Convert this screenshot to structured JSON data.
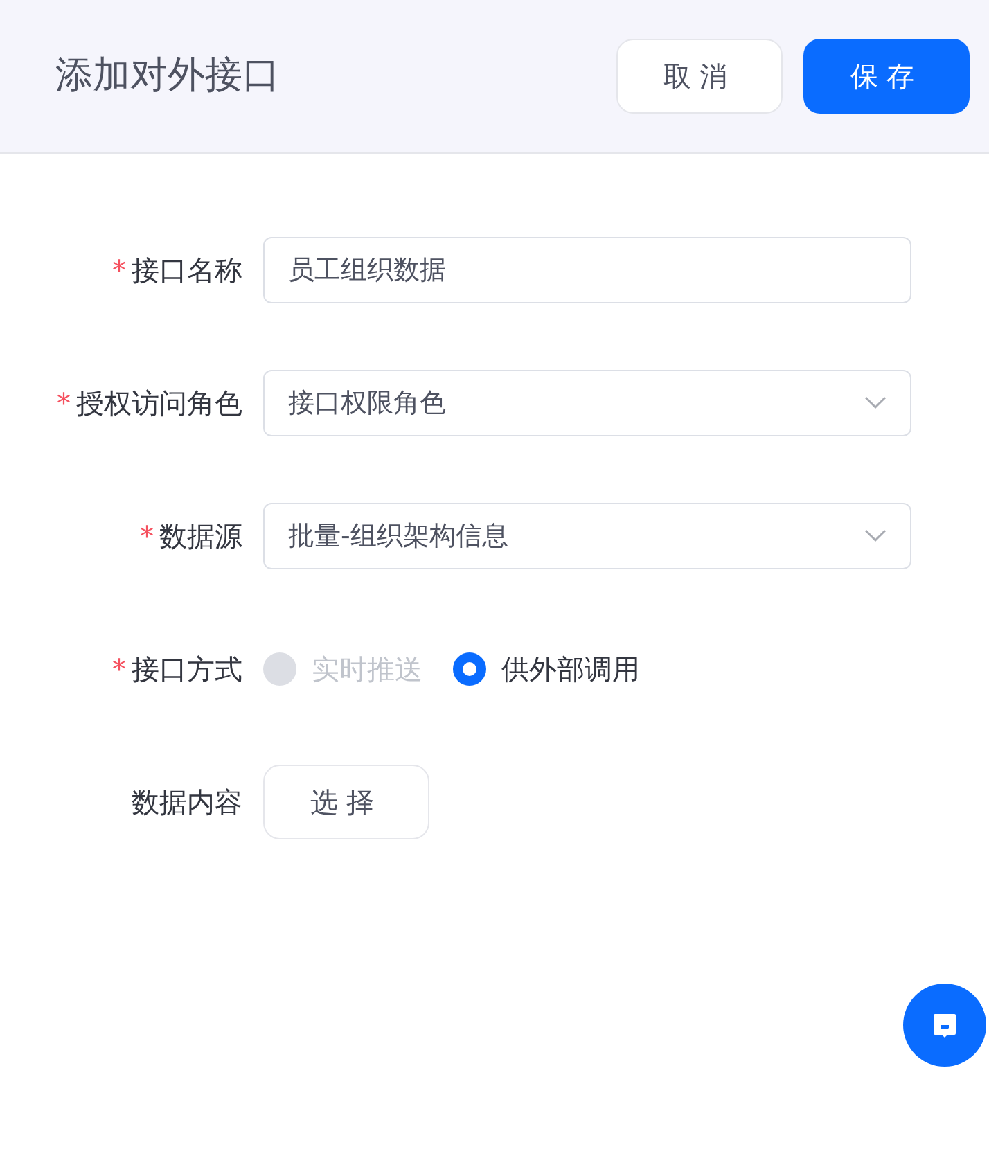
{
  "header": {
    "title": "添加对外接口",
    "buttons": [
      {
        "label": "取消",
        "kind": "secondary"
      },
      {
        "label": "保存",
        "kind": "primary"
      }
    ]
  },
  "form": {
    "fields": [
      {
        "kind": "input",
        "required_mark": "*",
        "label": "接口名称",
        "value": "员工组织数据"
      },
      {
        "kind": "select",
        "required_mark": "*",
        "label": "授权访问角色",
        "value": "接口权限角色"
      },
      {
        "kind": "select",
        "required_mark": "*",
        "label": "数据源",
        "value": "批量-组织架构信息"
      },
      {
        "kind": "radio",
        "required_mark": "*",
        "label": "接口方式",
        "options": [
          {
            "label": "实时推送",
            "selected": false,
            "disabled": true
          },
          {
            "label": "供外部调用",
            "selected": true,
            "disabled": false
          }
        ]
      },
      {
        "kind": "button",
        "label": "数据内容",
        "button": "选择"
      }
    ]
  }
}
